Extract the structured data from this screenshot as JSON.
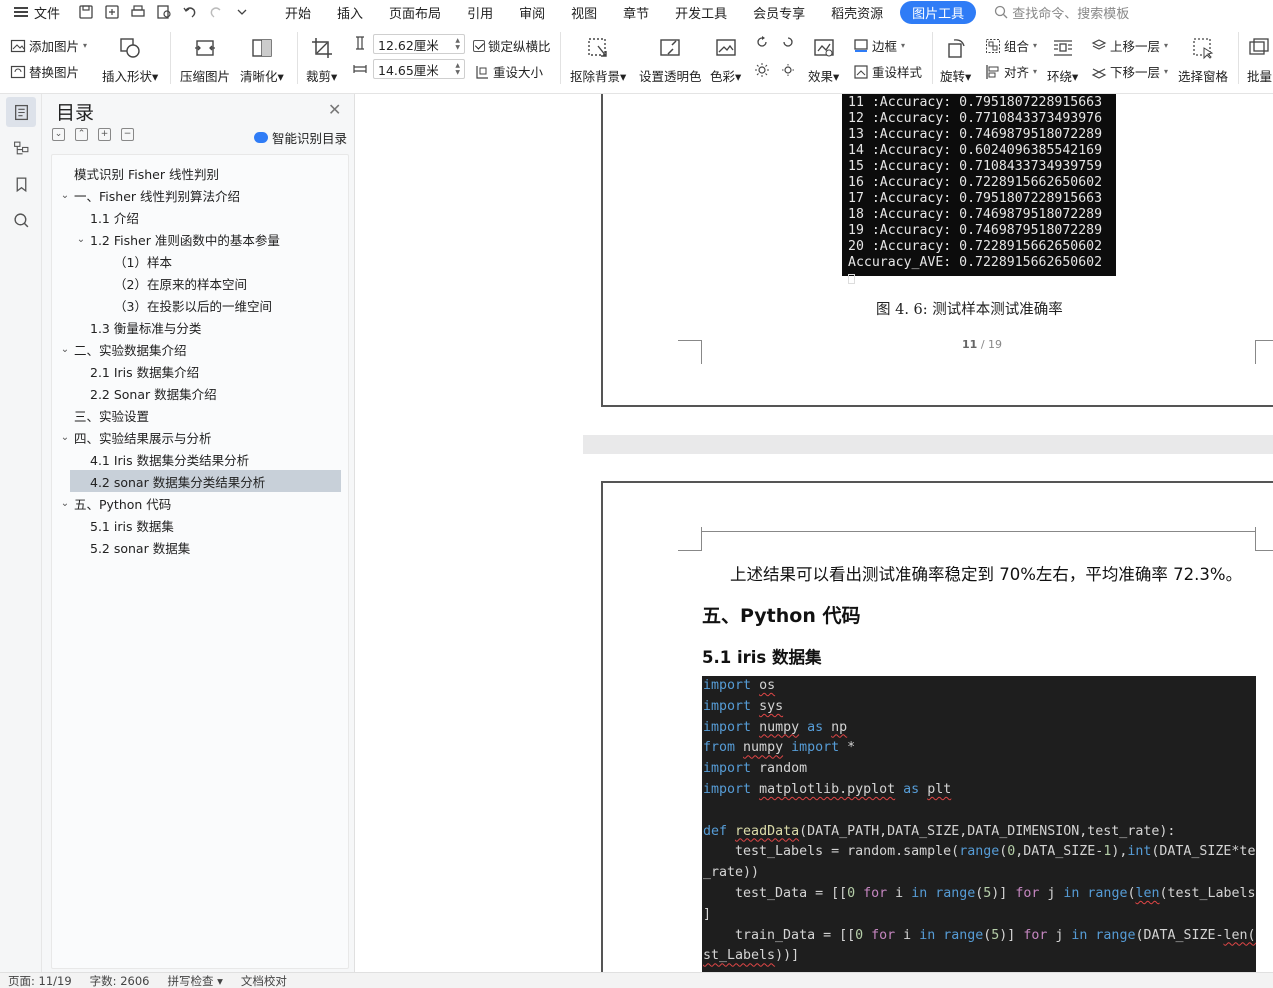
{
  "menubar": {
    "file_label": "文件",
    "tabs": [
      "开始",
      "插入",
      "页面布局",
      "引用",
      "审阅",
      "视图",
      "章节",
      "开发工具",
      "会员专享",
      "稻壳资源"
    ],
    "active_tab": "图片工具",
    "search_placeholder": "查找命令、搜索模板"
  },
  "ribbon": {
    "add_picture": "添加图片",
    "replace_picture": "替换图片",
    "insert_shape": "插入形状",
    "compress_picture": "压缩图片",
    "sharpen": "清晰化",
    "crop": "裁剪",
    "height_value": "12.62厘米",
    "width_value": "14.65厘米",
    "lock_aspect": "锁定纵横比",
    "reset_size": "重设大小",
    "remove_background": "抠除背景",
    "set_transparent": "设置透明色",
    "color": "色彩",
    "effects": "效果",
    "reset_style": "重设样式",
    "border": "边框",
    "rotate": "旋转",
    "group": "组合",
    "align": "对齐",
    "wrap": "环绕",
    "bring_forward": "上移一层",
    "send_backward": "下移一层",
    "selection_pane": "选择窗格",
    "batch": "批量"
  },
  "toc": {
    "title": "目录",
    "smart_label": "智能识别目录",
    "items": [
      {
        "label": "模式识别  Fisher 线性判别",
        "level": 0,
        "caret": ""
      },
      {
        "label": "一、Fisher 线性判别算法介绍",
        "level": 0,
        "caret": "v"
      },
      {
        "label": "1.1  介绍",
        "level": 1,
        "caret": ""
      },
      {
        "label": "1.2 Fisher 准则函数中的基本参量",
        "level": 1,
        "caret": "v"
      },
      {
        "label": "（1）样本",
        "level": 2,
        "caret": ""
      },
      {
        "label": "（2）在原来的样本空间",
        "level": 2,
        "caret": ""
      },
      {
        "label": "（3）在投影以后的一维空间",
        "level": 2,
        "caret": ""
      },
      {
        "label": "1.3  衡量标准与分类",
        "level": 1,
        "caret": ""
      },
      {
        "label": "二、实验数据集介绍",
        "level": 0,
        "caret": "v"
      },
      {
        "label": "2.1 Iris 数据集介绍",
        "level": 1,
        "caret": ""
      },
      {
        "label": "2.2 Sonar 数据集介绍",
        "level": 1,
        "caret": ""
      },
      {
        "label": "三、实验设置",
        "level": 0,
        "caret": ""
      },
      {
        "label": "四、实验结果展示与分析",
        "level": 0,
        "caret": "v"
      },
      {
        "label": "4.1 Iris 数据集分类结果分析",
        "level": 1,
        "caret": ""
      },
      {
        "label": "4.2 sonar 数据集分类结果分析",
        "level": 1,
        "caret": "",
        "selected": true
      },
      {
        "label": "五、Python 代码",
        "level": 0,
        "caret": "v"
      },
      {
        "label": "5.1 iris 数据集",
        "level": 1,
        "caret": ""
      },
      {
        "label": "5.2 sonar 数据集",
        "level": 1,
        "caret": ""
      }
    ]
  },
  "document": {
    "terminal_lines": [
      "11 :Accuracy: 0.7951807228915663",
      "12 :Accuracy: 0.7710843373493976",
      "13 :Accuracy: 0.7469879518072289",
      "14 :Accuracy: 0.6024096385542169",
      "15 :Accuracy: 0.7108433734939759",
      "16 :Accuracy: 0.7228915662650602",
      "17 :Accuracy: 0.7951807228915663",
      "18 :Accuracy: 0.7469879518072289",
      "19 :Accuracy: 0.7469879518072289",
      "20 :Accuracy: 0.7228915662650602",
      "Accuracy_AVE: 0.7228915662650602"
    ],
    "figure_caption": "图 4. 6: 测试样本测试准确率",
    "page_current": "11",
    "page_total": "/ 19",
    "paragraph": "上述结果可以看出测试准确率稳定到 70%左右，平均准确率 72.3%。",
    "heading_1": "五、Python 代码",
    "heading_2": "5.1 iris 数据集"
  },
  "status": {
    "page": "页面: 11/19",
    "words": "字数: 2606",
    "spell": "拼写检查",
    "proof": "文档校对"
  },
  "colors": {
    "accent": "#2f7cf6",
    "code_bg": "#1e1e1e",
    "keyword": "#569cd6",
    "terminal_bg": "#0c0c0c"
  }
}
